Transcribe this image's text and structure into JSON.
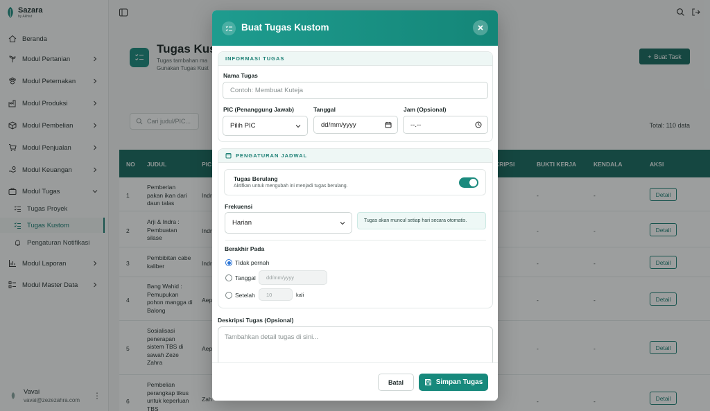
{
  "brand": {
    "name": "Sazara",
    "sub": "by Akhiut"
  },
  "sidebar": {
    "items": [
      {
        "label": "Beranda"
      },
      {
        "label": "Modul Pertanian"
      },
      {
        "label": "Modul Peternakan"
      },
      {
        "label": "Modul Produksi"
      },
      {
        "label": "Modul Pembelian"
      },
      {
        "label": "Modul Penjualan"
      },
      {
        "label": "Modul Keuangan"
      },
      {
        "label": "Modul Tugas"
      },
      {
        "label": "Modul Laporan"
      },
      {
        "label": "Modul Master Data"
      }
    ],
    "sub_items": [
      {
        "label": "Tugas Proyek"
      },
      {
        "label": "Tugas Kustom"
      },
      {
        "label": "Pengaturan Notifikasi"
      }
    ],
    "user": {
      "name": "Vavai",
      "email": "vavai@zezezahra.com"
    }
  },
  "page": {
    "title": "Tugas Kust",
    "sub1": "Tugas tambahan ma",
    "sub2": "Gunakan Tugas Kust",
    "create_label": "Buat Task",
    "search_placeholder": "Cari judul/PIC...",
    "total": "Total: 110 data"
  },
  "table": {
    "headers": {
      "no": "NO",
      "judul": "JUDUL",
      "pic": "PIC",
      "deskripsi": "KRIPSI",
      "bukti": "BUKTI KERJA",
      "kendala": "KENDALA",
      "aksi": "AKSI"
    },
    "rows": [
      {
        "no": "1",
        "judul": "Pemberian pakan ikan dari daun talas",
        "pic": "Indr",
        "bukti": "-",
        "kendala": "-",
        "aksi": "Detail"
      },
      {
        "no": "2",
        "judul": "Arji & Indra : Pembuatan silase",
        "pic": "Indr",
        "bukti": "-",
        "kendala": "-",
        "aksi": "Detail"
      },
      {
        "no": "3",
        "judul": "Pembibitan cabe kaliber",
        "pic": "Indr",
        "bukti": "-",
        "kendala": "-",
        "aksi": "Detail"
      },
      {
        "no": "4",
        "judul": "Bang Wahid : Pemupukan pohon mangga di Balong",
        "pic": "Aep",
        "bukti": "-",
        "kendala": "-",
        "aksi": "Detail"
      },
      {
        "no": "5",
        "judul": "Sosialisasi penerapan sistem TBS di sawah Zeze Zahra",
        "pic": "Aep",
        "bukti": "-",
        "kendala": "-",
        "aksi": "Detail"
      },
      {
        "no": "6",
        "judul": "Pembelian perangkap tikus untuk keperluan TBS",
        "pic": "Zah",
        "bukti": "-",
        "kendala": "-",
        "aksi": "Detail"
      }
    ]
  },
  "modal": {
    "title": "Buat Tugas Kustom",
    "info_section": "INFORMASI TUGAS",
    "nama_label": "Nama Tugas",
    "nama_placeholder": "Contoh: Membuat Kuteja",
    "pic_label": "PIC (Penanggung Jawab)",
    "pic_value": "Pilih PIC",
    "tanggal_label": "Tanggal",
    "tanggal_value": "dd/mm/yyyy",
    "jam_label": "Jam (Opsional)",
    "jam_value": "--.--",
    "schedule_section": "PENGATURAN JADWAL",
    "repeat_title": "Tugas Berulang",
    "repeat_sub": "Aktifkan untuk mengubah ini menjadi tugas berulang.",
    "repeat_on": true,
    "frekuensi_label": "Frekuensi",
    "frekuensi_value": "Harian",
    "frekuensi_note": "Tugas akan muncul setiap hari secara otomatis.",
    "berakhir_label": "Berakhir Pada",
    "opt_never": "Tidak pernah",
    "opt_date": "Tanggal",
    "opt_date_placeholder": "dd/mm/yyyy",
    "opt_after": "Setelah",
    "opt_after_value": "10",
    "opt_after_unit": "kali",
    "deskripsi_label": "Deskripsi Tugas (Opsional)",
    "deskripsi_placeholder": "Tambahkan detail tugas di sini...",
    "cancel_label": "Batal",
    "save_label": "Simpan Tugas"
  },
  "colors": {
    "accent": "#1b8a7e",
    "accent_dark": "#17695f",
    "radio": "#2a74d6"
  }
}
